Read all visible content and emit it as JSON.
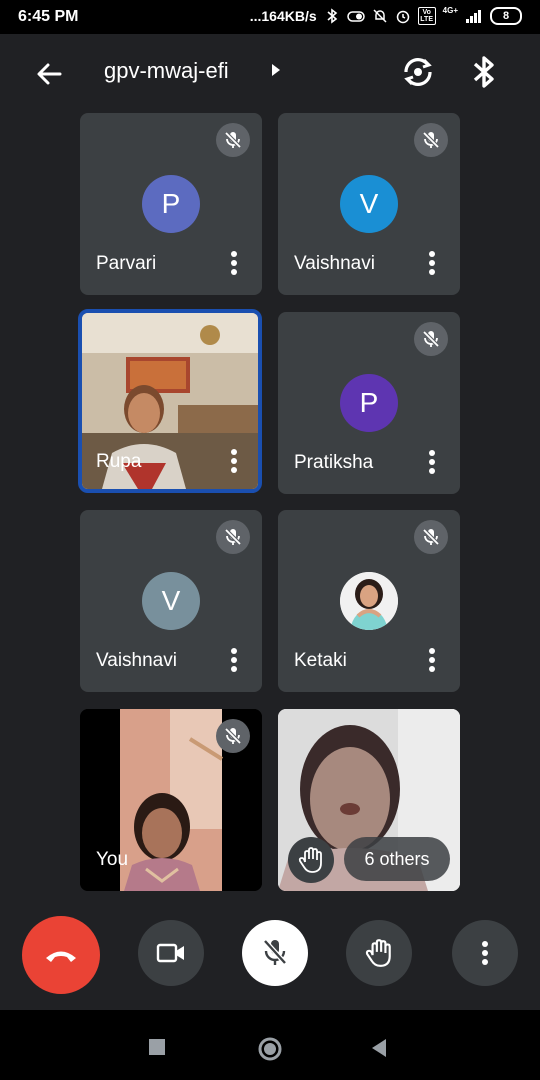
{
  "status_bar": {
    "time": "6:45 PM",
    "network_speed": "...164KB/s",
    "network_type": "4G+",
    "volte_label": "Vo LTE",
    "battery": "8"
  },
  "header": {
    "meeting_code": "gpv-mwaj-efi",
    "icons": [
      "back-arrow-icon",
      "chevron-right-icon",
      "switch-camera-icon",
      "bluetooth-icon"
    ]
  },
  "tiles": [
    {
      "name": "Parvari",
      "initial": "P",
      "avatar_color": "#5c6bc0",
      "muted": true
    },
    {
      "name": "Vaishnavi",
      "initial": "V",
      "avatar_color": "#1a8fd4",
      "muted": true
    },
    {
      "name": "Rupa",
      "muted": false,
      "video": true,
      "speaking": true
    },
    {
      "name": "Pratiksha",
      "initial": "P",
      "avatar_color": "#5e35b1",
      "muted": true
    },
    {
      "name": "Vaishnavi",
      "initial": "V",
      "avatar_color": "#78909c",
      "muted": true
    },
    {
      "name": "Ketaki",
      "muted": true,
      "photo_avatar": true
    },
    {
      "name": "You",
      "muted": true,
      "video": true
    },
    {
      "others_label": "6 others",
      "hand_raised": true,
      "video": true
    }
  ],
  "controls": {
    "end_call_color": "#ea4335",
    "buttons": [
      "end-call-icon",
      "camera-icon",
      "mic-off-icon",
      "raise-hand-icon",
      "more-vert-icon"
    ]
  },
  "colors": {
    "background": "#202124",
    "tile": "#3c4043",
    "active_border": "#1a4fb0"
  }
}
